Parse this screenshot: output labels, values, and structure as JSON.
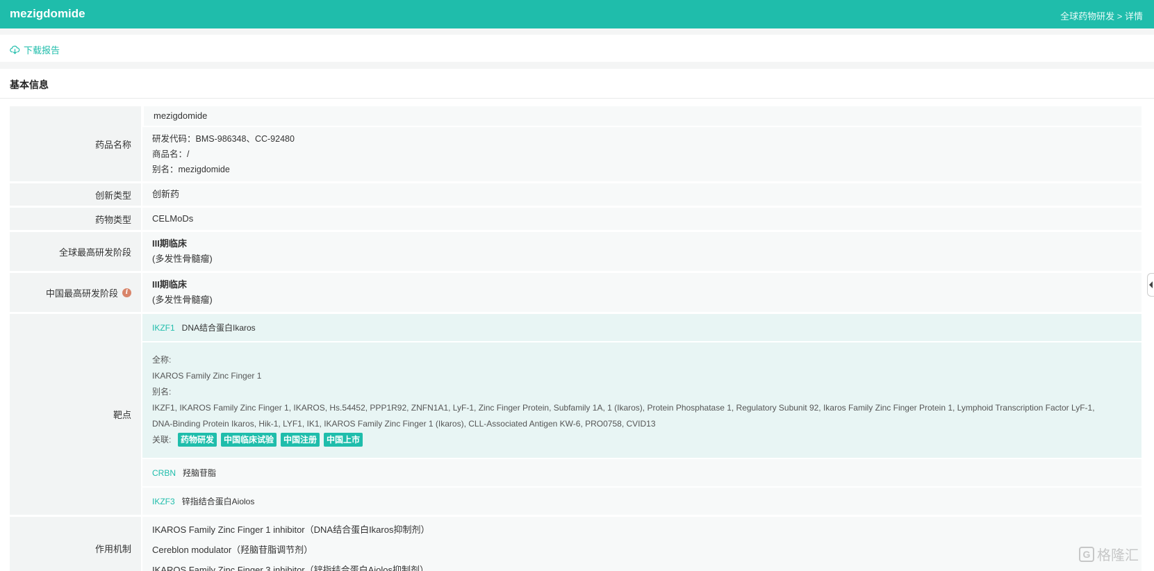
{
  "header": {
    "title": "mezigdomide",
    "breadcrumb": "全球药物研发 > 详情"
  },
  "toolbar": {
    "download_label": "下载报告"
  },
  "section": {
    "title": "基本信息"
  },
  "drug": {
    "name_label": "药品名称",
    "name": "mezigdomide",
    "code_line": "研发代码：BMS-986348、CC-92480",
    "trade_line": "商品名：/",
    "alias_line": "别名：mezigdomide",
    "innovation_label": "创新类型",
    "innovation": "创新药",
    "type_label": "药物类型",
    "type": "CELMoDs",
    "global_stage_label": "全球最高研发阶段",
    "global_stage": "III期临床",
    "global_stage_ind": "(多发性骨髓瘤)",
    "china_stage_label": "中国最高研发阶段",
    "china_stage": "III期临床",
    "china_stage_ind": "(多发性骨髓瘤)",
    "target_label": "靶点",
    "mechanism_label": "作用机制"
  },
  "targets": [
    {
      "code": "IKZF1",
      "name": "DNA结合蛋白Ikaros",
      "fullname_key": "全称:",
      "fullname": "IKAROS Family Zinc Finger 1",
      "alias_key": "别名:",
      "alias": "IKZF1, IKAROS Family Zinc Finger 1, IKAROS, Hs.54452, PPP1R92, ZNFN1A1, LyF-1, Zinc Finger Protein, Subfamily 1A, 1 (Ikaros), Protein Phosphatase 1, Regulatory Subunit 92, Ikaros Family Zinc Finger Protein 1, Lymphoid Transcription Factor LyF-1, DNA-Binding Protein Ikaros, Hik-1, LYF1, IK1, IKAROS Family Zinc Finger 1 (Ikaros), CLL-Associated Antigen KW-6, PRO0758, CVID13",
      "related_key": "关联:",
      "tags": [
        "药物研发",
        "中国临床试验",
        "中国注册",
        "中国上市"
      ]
    },
    {
      "code": "CRBN",
      "name": "羟脑苷脂"
    },
    {
      "code": "IKZF3",
      "name": "锌指结合蛋白Aiolos"
    }
  ],
  "mechanisms": [
    "IKAROS Family Zinc Finger 1 inhibitor（DNA结合蛋白Ikaros抑制剂）",
    "Cereblon modulator（羟脑苷脂调节剂）",
    "IKAROS Family Zinc Finger 3 inhibitor（锌指结合蛋白Aiolos抑制剂）"
  ],
  "watermark": {
    "mark": "G",
    "text": "格隆汇"
  },
  "colors": {
    "accent": "#1fbdab",
    "info_icon": "#d9856a"
  },
  "icons": {
    "download": "cloud-download-icon",
    "info": "info-icon",
    "collapse": "collapse-arrow-icon"
  }
}
